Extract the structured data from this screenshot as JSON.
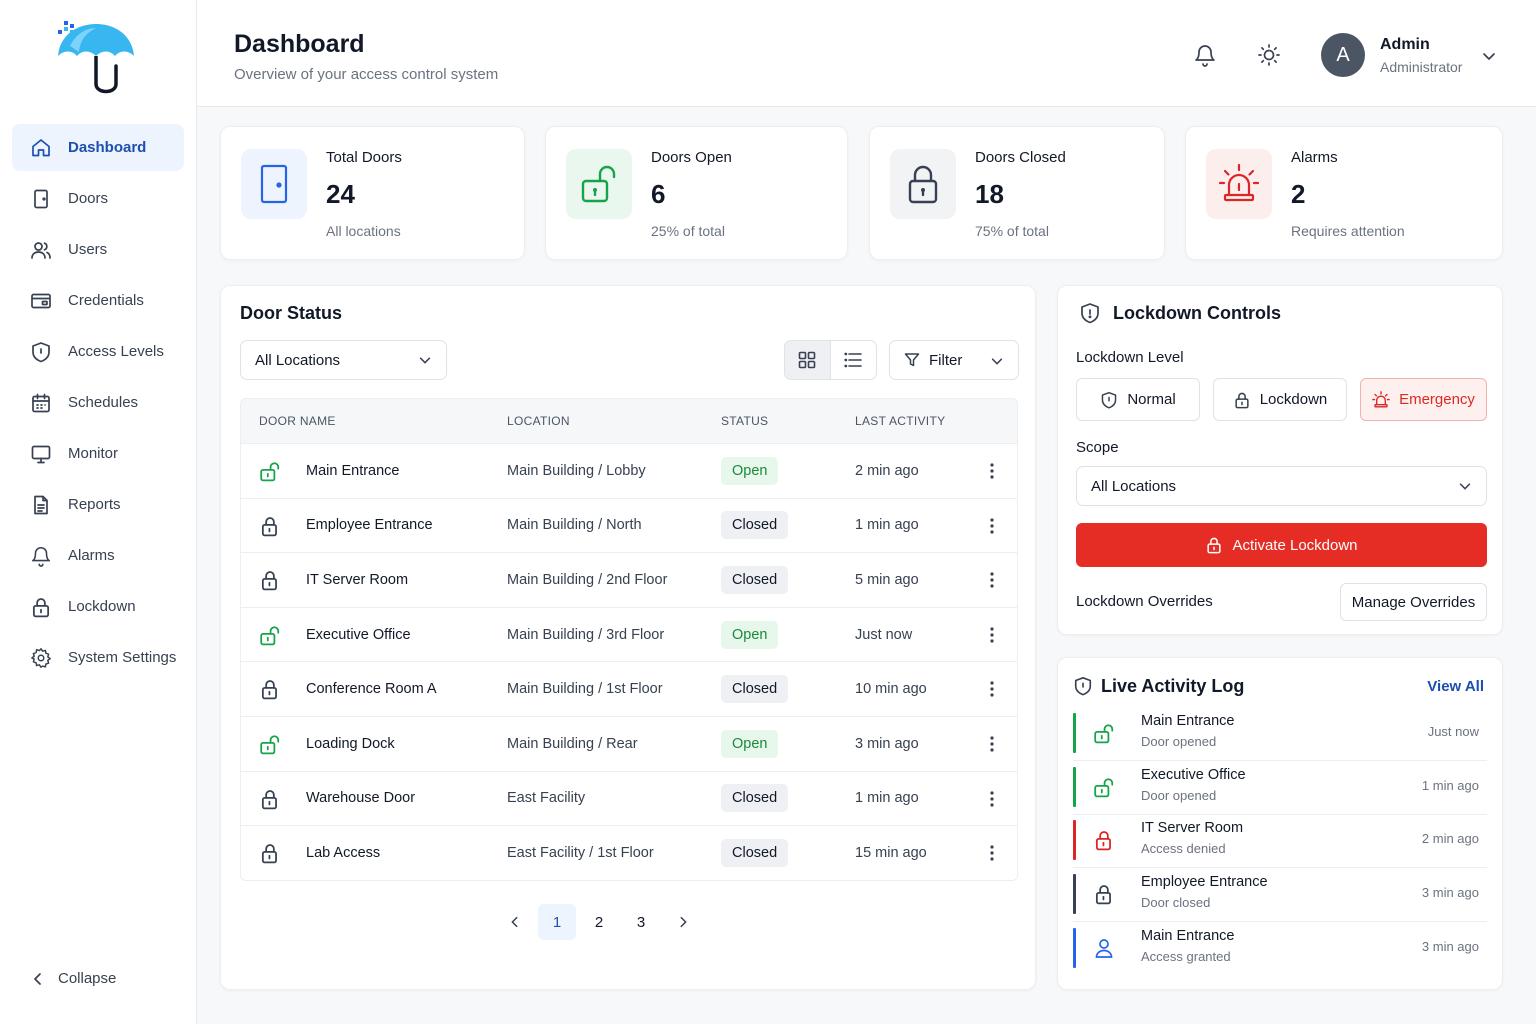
{
  "sidebar": {
    "items": [
      {
        "label": "Dashboard",
        "icon": "home-icon"
      },
      {
        "label": "Doors",
        "icon": "door-icon"
      },
      {
        "label": "Users",
        "icon": "users-icon"
      },
      {
        "label": "Credentials",
        "icon": "card-icon"
      },
      {
        "label": "Access Levels",
        "icon": "shield-icon"
      },
      {
        "label": "Schedules",
        "icon": "calendar-icon"
      },
      {
        "label": "Monitor",
        "icon": "monitor-icon"
      },
      {
        "label": "Reports",
        "icon": "file-icon"
      },
      {
        "label": "Alarms",
        "icon": "bell-icon"
      },
      {
        "label": "Lockdown",
        "icon": "lock-icon"
      },
      {
        "label": "System Settings",
        "icon": "gear-icon"
      }
    ],
    "active": "Dashboard",
    "collapse_label": "Collapse"
  },
  "header": {
    "title": "Dashboard",
    "subtitle": "Overview of your access control system",
    "user": {
      "initial": "A",
      "name": "Admin",
      "role": "Administrator"
    }
  },
  "stats": [
    {
      "label": "Total Doors",
      "value": "24",
      "note": "All locations",
      "color": "#2563eb"
    },
    {
      "label": "Doors Open",
      "value": "6",
      "note": "25% of total",
      "color": "#16a34a"
    },
    {
      "label": "Doors Closed",
      "value": "18",
      "note": "75% of total",
      "color": "#374151"
    },
    {
      "label": "Alarms",
      "value": "2",
      "note": "Requires attention",
      "color": "#dc2626"
    }
  ],
  "door_status": {
    "title": "Door Status",
    "location_filter": "All Locations",
    "filter_label": "Filter",
    "columns": [
      "DOOR NAME",
      "LOCATION",
      "STATUS",
      "LAST ACTIVITY"
    ],
    "rows": [
      {
        "name": "Main Entrance",
        "location": "Main Building / Lobby",
        "status": "Open",
        "activity": "2 min ago"
      },
      {
        "name": "Employee Entrance",
        "location": "Main Building / North",
        "status": "Closed",
        "activity": "1 min ago"
      },
      {
        "name": "IT Server Room",
        "location": "Main Building / 2nd Floor",
        "status": "Closed",
        "activity": "5 min ago"
      },
      {
        "name": "Executive Office",
        "location": "Main Building / 3rd Floor",
        "status": "Open",
        "activity": "Just now"
      },
      {
        "name": "Conference Room A",
        "location": "Main Building / 1st Floor",
        "status": "Closed",
        "activity": "10 min ago"
      },
      {
        "name": "Loading Dock",
        "location": "Main Building / Rear",
        "status": "Open",
        "activity": "3 min ago"
      },
      {
        "name": "Warehouse Door",
        "location": "East Facility",
        "status": "Closed",
        "activity": "1 min ago"
      },
      {
        "name": "Lab Access",
        "location": "East Facility / 1st Floor",
        "status": "Closed",
        "activity": "15 min ago"
      }
    ],
    "pages": [
      "1",
      "2",
      "3"
    ],
    "current_page": "1"
  },
  "lockdown": {
    "title": "Lockdown Controls",
    "level_label": "Lockdown Level",
    "levels": [
      "Normal",
      "Lockdown",
      "Emergency"
    ],
    "selected_level": "Emergency",
    "scope_label": "Scope",
    "scope_value": "All Locations",
    "activate_label": "Activate Lockdown",
    "overrides_label": "Lockdown Overrides",
    "manage_label": "Manage Overrides",
    "accent": "#e52d26"
  },
  "activity": {
    "title": "Live Activity Log",
    "view_all": "View All",
    "items": [
      {
        "title": "Main Entrance",
        "sub": "Door opened",
        "time": "Just now",
        "kind": "open",
        "color": "#16a34a"
      },
      {
        "title": "Executive Office",
        "sub": "Door opened",
        "time": "1 min ago",
        "kind": "open",
        "color": "#16a34a"
      },
      {
        "title": "IT Server Room",
        "sub": "Access denied",
        "time": "2 min ago",
        "kind": "denied",
        "color": "#dc2626"
      },
      {
        "title": "Employee Entrance",
        "sub": "Door closed",
        "time": "3 min ago",
        "kind": "closed",
        "color": "#374151"
      },
      {
        "title": "Main Entrance",
        "sub": "Access granted",
        "time": "3 min ago",
        "kind": "granted",
        "color": "#2563eb"
      }
    ]
  }
}
